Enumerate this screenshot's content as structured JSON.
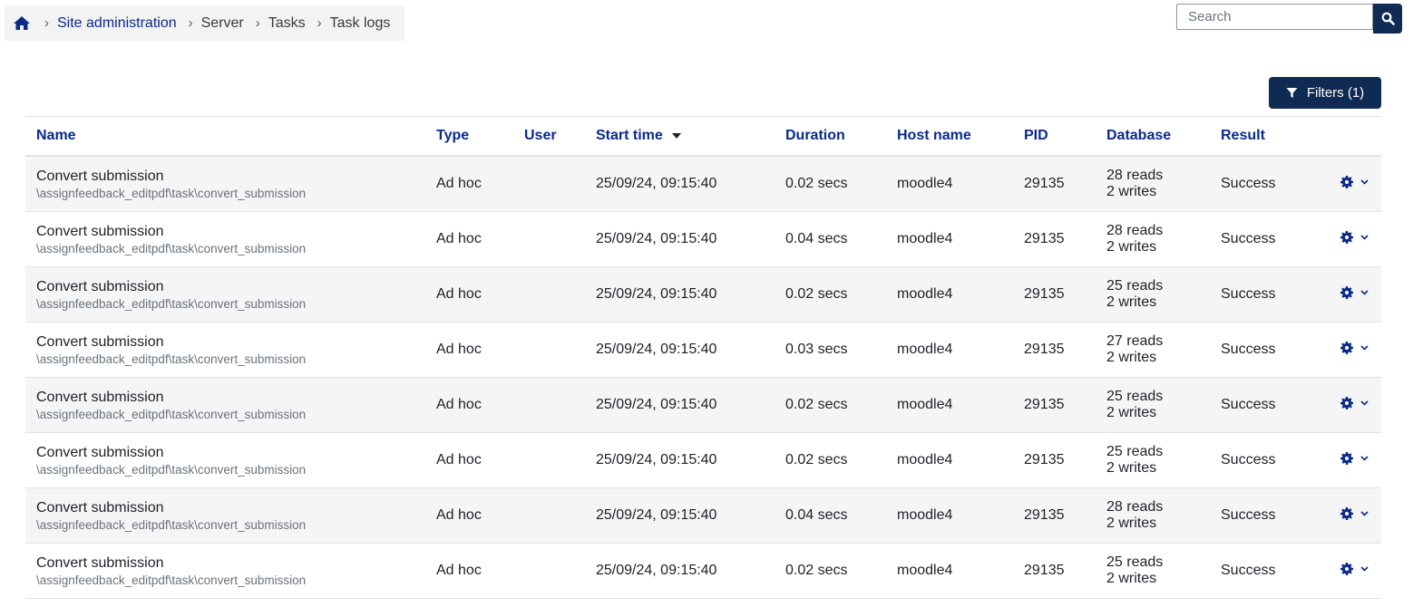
{
  "breadcrumb": {
    "home_icon": "home-icon",
    "items": [
      "Site administration",
      "Server",
      "Tasks",
      "Task logs"
    ]
  },
  "search": {
    "placeholder": "Search",
    "icon": "search-icon"
  },
  "filters": {
    "label": "Filters (1)",
    "icon": "filter-icon"
  },
  "table": {
    "headers": {
      "name": "Name",
      "type": "Type",
      "user": "User",
      "start": "Start time",
      "duration": "Duration",
      "host": "Host name",
      "pid": "PID",
      "database": "Database",
      "result": "Result"
    },
    "sort_icon": "caret-down-icon",
    "rows": [
      {
        "name": "Convert submission",
        "classname": "\\assignfeedback_editpdf\\task\\convert_submission",
        "type": "Ad hoc",
        "user": "",
        "start": "25/09/24, 09:15:40",
        "duration": "0.02 secs",
        "host": "moodle4",
        "pid": "29135",
        "reads": "28 reads",
        "writes": "2 writes",
        "result": "Success"
      },
      {
        "name": "Convert submission",
        "classname": "\\assignfeedback_editpdf\\task\\convert_submission",
        "type": "Ad hoc",
        "user": "",
        "start": "25/09/24, 09:15:40",
        "duration": "0.04 secs",
        "host": "moodle4",
        "pid": "29135",
        "reads": "28 reads",
        "writes": "2 writes",
        "result": "Success"
      },
      {
        "name": "Convert submission",
        "classname": "\\assignfeedback_editpdf\\task\\convert_submission",
        "type": "Ad hoc",
        "user": "",
        "start": "25/09/24, 09:15:40",
        "duration": "0.02 secs",
        "host": "moodle4",
        "pid": "29135",
        "reads": "25 reads",
        "writes": "2 writes",
        "result": "Success"
      },
      {
        "name": "Convert submission",
        "classname": "\\assignfeedback_editpdf\\task\\convert_submission",
        "type": "Ad hoc",
        "user": "",
        "start": "25/09/24, 09:15:40",
        "duration": "0.03 secs",
        "host": "moodle4",
        "pid": "29135",
        "reads": "27 reads",
        "writes": "2 writes",
        "result": "Success"
      },
      {
        "name": "Convert submission",
        "classname": "\\assignfeedback_editpdf\\task\\convert_submission",
        "type": "Ad hoc",
        "user": "",
        "start": "25/09/24, 09:15:40",
        "duration": "0.02 secs",
        "host": "moodle4",
        "pid": "29135",
        "reads": "25 reads",
        "writes": "2 writes",
        "result": "Success"
      },
      {
        "name": "Convert submission",
        "classname": "\\assignfeedback_editpdf\\task\\convert_submission",
        "type": "Ad hoc",
        "user": "",
        "start": "25/09/24, 09:15:40",
        "duration": "0.02 secs",
        "host": "moodle4",
        "pid": "29135",
        "reads": "25 reads",
        "writes": "2 writes",
        "result": "Success"
      },
      {
        "name": "Convert submission",
        "classname": "\\assignfeedback_editpdf\\task\\convert_submission",
        "type": "Ad hoc",
        "user": "",
        "start": "25/09/24, 09:15:40",
        "duration": "0.04 secs",
        "host": "moodle4",
        "pid": "29135",
        "reads": "28 reads",
        "writes": "2 writes",
        "result": "Success"
      },
      {
        "name": "Convert submission",
        "classname": "\\assignfeedback_editpdf\\task\\convert_submission",
        "type": "Ad hoc",
        "user": "",
        "start": "25/09/24, 09:15:40",
        "duration": "0.02 secs",
        "host": "moodle4",
        "pid": "29135",
        "reads": "25 reads",
        "writes": "2 writes",
        "result": "Success"
      }
    ],
    "row_action_icons": [
      "gear-icon",
      "chevron-down-icon"
    ]
  },
  "colors": {
    "accent": "#0f2b54",
    "link": "#0a2a8a",
    "stripe": "#f5f5f5",
    "breadcrumb_bg": "#f3f3f3"
  }
}
